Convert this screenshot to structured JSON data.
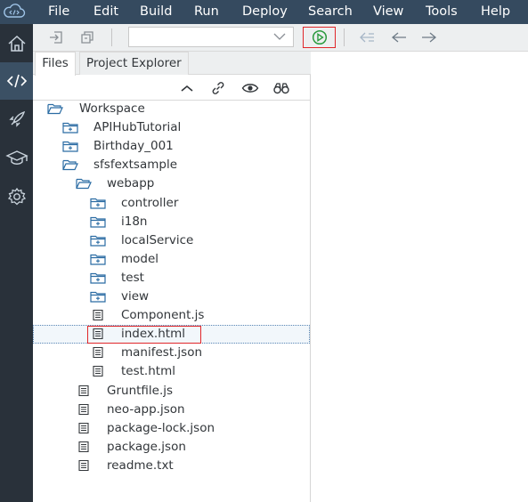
{
  "menubar": {
    "logo_icon": "cloud-code-icon",
    "items": [
      "File",
      "Edit",
      "Build",
      "Run",
      "Deploy",
      "Search",
      "View",
      "Tools",
      "Help"
    ]
  },
  "rail": {
    "items": [
      {
        "icon": "home-icon",
        "active": false
      },
      {
        "icon": "code-icon",
        "active": true
      },
      {
        "icon": "rocket-icon",
        "active": false
      },
      {
        "icon": "learning-icon",
        "active": false
      },
      {
        "icon": "settings-icon",
        "active": false
      }
    ]
  },
  "toolbar": {
    "run_config_value": "",
    "icons": [
      "import-icon",
      "export-icon",
      "chevron-down-icon",
      "run-icon",
      "collapse-back-icon",
      "back-icon",
      "forward-icon"
    ]
  },
  "panel": {
    "tabs": [
      {
        "label": "Files",
        "active": true
      },
      {
        "label": "Project Explorer",
        "active": false
      }
    ],
    "tree_tools": [
      "collapse-icon",
      "link-icon",
      "show-hidden-icon",
      "search-binoculars-icon"
    ]
  },
  "tree": [
    {
      "label": "Workspace",
      "type": "folder-open",
      "depth": 0
    },
    {
      "label": "APIHubTutorial",
      "type": "folder-closed",
      "depth": 1
    },
    {
      "label": "Birthday_001",
      "type": "folder-closed",
      "depth": 1
    },
    {
      "label": "sfsfextsample",
      "type": "folder-open",
      "depth": 1
    },
    {
      "label": "webapp",
      "type": "folder-open",
      "depth": 2
    },
    {
      "label": "controller",
      "type": "folder-closed",
      "depth": 3
    },
    {
      "label": "i18n",
      "type": "folder-closed",
      "depth": 3
    },
    {
      "label": "localService",
      "type": "folder-closed",
      "depth": 3
    },
    {
      "label": "model",
      "type": "folder-closed",
      "depth": 3
    },
    {
      "label": "test",
      "type": "folder-closed",
      "depth": 3
    },
    {
      "label": "view",
      "type": "folder-closed",
      "depth": 3
    },
    {
      "label": "Component.js",
      "type": "file",
      "depth": 3
    },
    {
      "label": "index.html",
      "type": "file",
      "depth": 3,
      "selected": true
    },
    {
      "label": "manifest.json",
      "type": "file",
      "depth": 3
    },
    {
      "label": "test.html",
      "type": "file",
      "depth": 3
    },
    {
      "label": "Gruntfile.js",
      "type": "file",
      "depth": 2
    },
    {
      "label": "neo-app.json",
      "type": "file",
      "depth": 2
    },
    {
      "label": "package-lock.json",
      "type": "file",
      "depth": 2
    },
    {
      "label": "package.json",
      "type": "file",
      "depth": 2
    },
    {
      "label": "readme.txt",
      "type": "file",
      "depth": 2
    }
  ],
  "colors": {
    "menubar": "#354a5f",
    "rail": "#29313a",
    "rail_active": "#3b5064",
    "icon_blue": "#2b6ca3",
    "run_green": "#2b9a3e",
    "highlight_red": "#e0262a"
  }
}
